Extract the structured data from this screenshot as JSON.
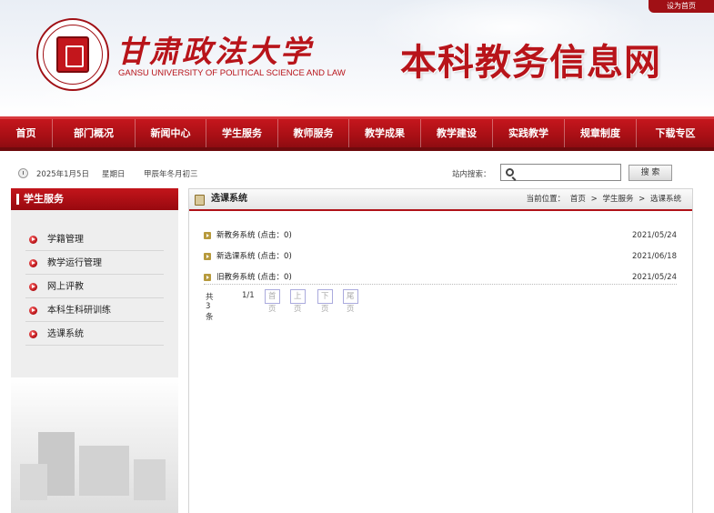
{
  "header": {
    "top_link": "设为首页",
    "university_cn": "甘肃政法大学",
    "university_en": "GANSU UNIVERSITY OF POLITICAL SCIENCE AND LAW",
    "site_title": "本科教务信息网"
  },
  "nav": {
    "items": [
      "首页",
      "部门概况",
      "新闻中心",
      "学生服务",
      "教师服务",
      "教学成果",
      "教学建设",
      "实践教学",
      "规章制度",
      "下载专区"
    ]
  },
  "infobar": {
    "date": "2025年1月5日",
    "weekday": "星期日",
    "lunar": "甲辰年冬月初三",
    "search_label": "站内搜索：",
    "search_value": "",
    "search_button": "搜 索"
  },
  "sidebar": {
    "title": "学生服务",
    "items": [
      "学籍管理",
      "教学运行管理",
      "网上评教",
      "本科生科研训练",
      "选课系统"
    ]
  },
  "main": {
    "title": "选课系统",
    "breadcrumb_label": "当前位置：",
    "breadcrumb": [
      "首页",
      ">",
      "学生服务",
      ">",
      "选课系统"
    ],
    "rows": [
      {
        "title": "新教务系统",
        "clicks": "(点击：0)",
        "date": "2021/05/24"
      },
      {
        "title": "新选课系统",
        "clicks": "(点击：0)",
        "date": "2021/06/18"
      },
      {
        "title": "旧教务系统",
        "clicks": "(点击：0)",
        "date": "2021/05/24"
      }
    ],
    "pager": {
      "total": "共3条",
      "page": "1/1",
      "first": "首页",
      "prev": "上页",
      "next": "下页",
      "last": "尾页"
    }
  },
  "colors": {
    "brand_red": "#b8141a",
    "nav_red": "#a80f15"
  }
}
